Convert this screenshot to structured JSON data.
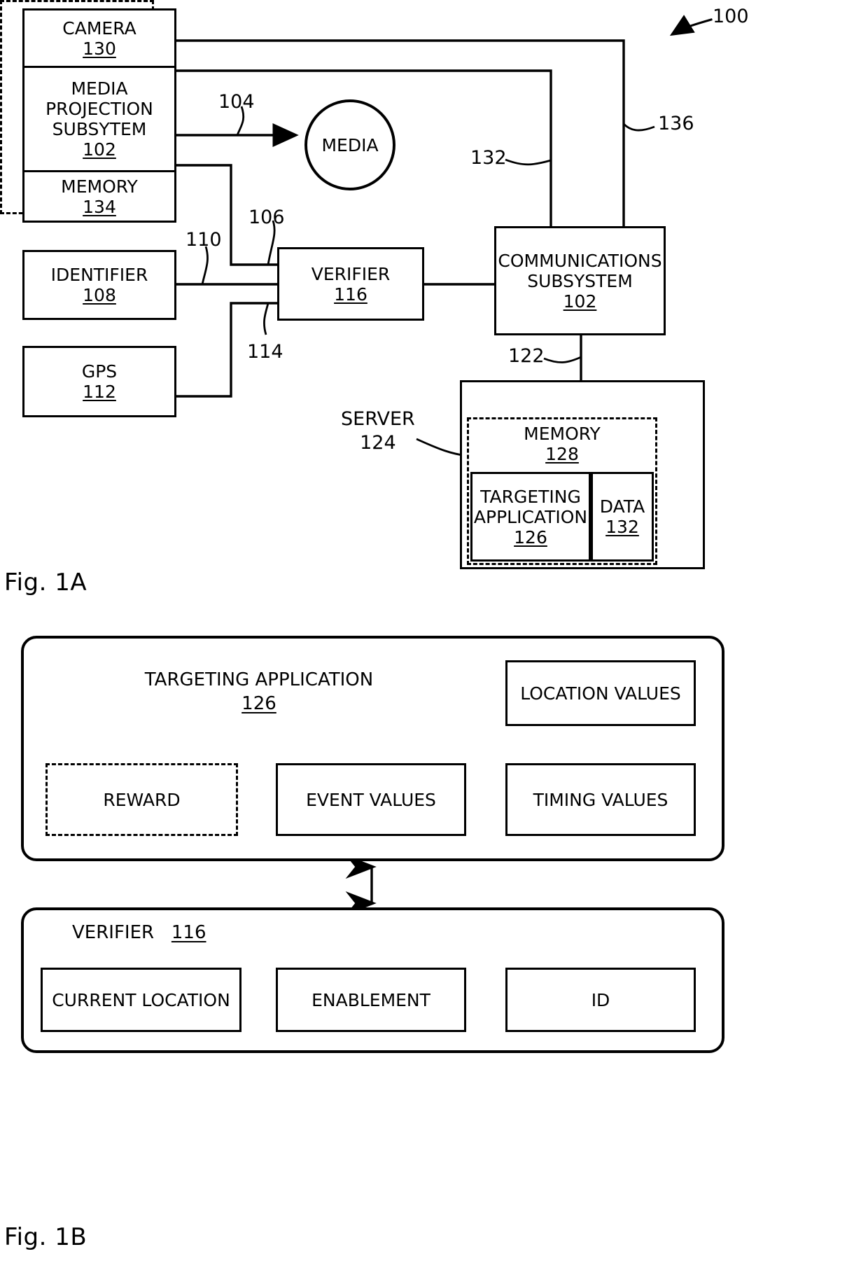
{
  "figures": [
    {
      "id": "fig1a",
      "caption": "Fig. 1A"
    },
    {
      "id": "fig1b",
      "caption": "Fig. 1B"
    }
  ],
  "fig1a": {
    "system_ref": "100",
    "blocks": {
      "camera": {
        "label": "CAMERA",
        "num": "130"
      },
      "media_projection": {
        "label_line1": "MEDIA",
        "label_line2": "PROJECTION",
        "label_line3": "SUBSYTEM",
        "num": "102"
      },
      "device_memory": {
        "label": "MEMORY",
        "num": "134"
      },
      "media": {
        "label": "MEDIA"
      },
      "identifier": {
        "label": "IDENTIFIER",
        "num": "108"
      },
      "gps": {
        "label": "GPS",
        "num": "112"
      },
      "verifier": {
        "label": "VERIFIER",
        "num": "116"
      },
      "communications": {
        "label_line1": "COMMUNICATIONS",
        "label_line2": "SUBSYSTEM",
        "num": "102"
      },
      "server": {
        "label": "SERVER",
        "num": "124"
      },
      "server_memory": {
        "label": "MEMORY",
        "num": "128"
      },
      "targeting_application": {
        "label_line1": "TARGETING",
        "label_line2": "APPLICATION",
        "num": "126"
      },
      "data": {
        "label": "DATA",
        "num": "132"
      }
    },
    "connector_refs": {
      "media_link": "104",
      "projection_to_verifier": "106",
      "identifier_to_verifier": "110",
      "gps_to_verifier": "114",
      "comms_to_projection": "132",
      "comms_to_camera": "136",
      "comms_to_server": "122"
    }
  },
  "fig1b": {
    "targeting_application": {
      "title": "TARGETING APPLICATION",
      "num": "126",
      "items": [
        {
          "label": "LOCATION VALUES",
          "style": "solid"
        },
        {
          "label": "REWARD",
          "style": "dashed"
        },
        {
          "label": "EVENT VALUES",
          "style": "solid"
        },
        {
          "label": "TIMING VALUES",
          "style": "solid"
        }
      ]
    },
    "verifier": {
      "title": "VERIFIER",
      "num": "116",
      "items": [
        {
          "label": "CURRENT LOCATION",
          "style": "solid"
        },
        {
          "label": "ENABLEMENT",
          "style": "solid"
        },
        {
          "label": "ID",
          "style": "solid"
        }
      ]
    }
  },
  "colors": {
    "stroke": "#000000",
    "background": "#ffffff"
  }
}
